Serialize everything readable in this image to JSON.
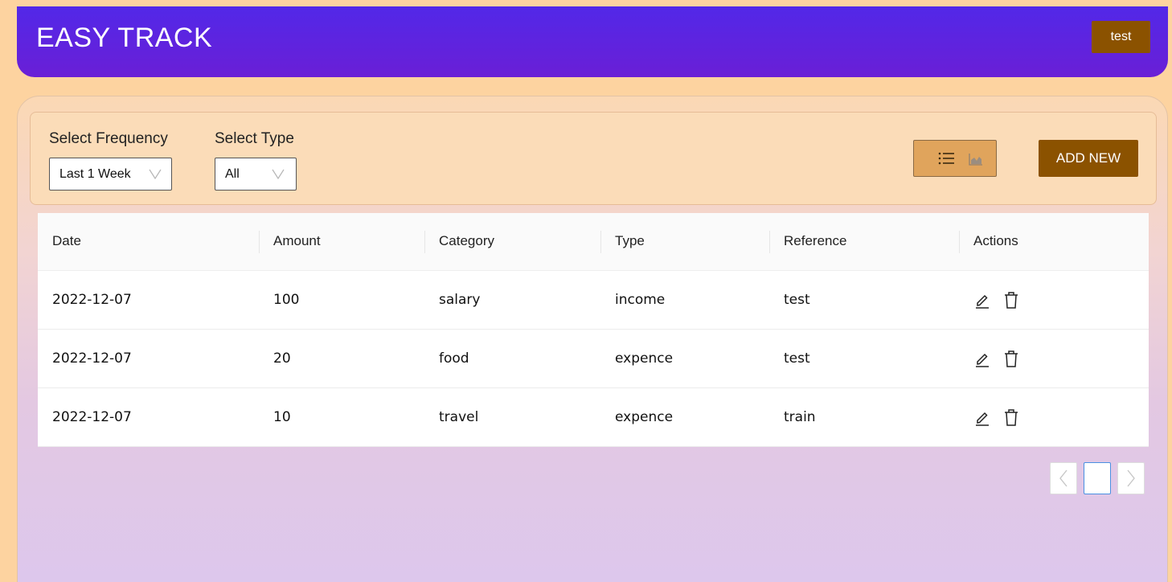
{
  "header": {
    "brand": "EASY TRACK",
    "user_label": "test"
  },
  "filters": {
    "frequency": {
      "label": "Select Frequency",
      "value": "Last 1 Week"
    },
    "type": {
      "label": "Select Type",
      "value": "All"
    }
  },
  "toolbar": {
    "list_icon": "list-icon",
    "chart_icon": "area-chart-icon",
    "add_label": "ADD NEW"
  },
  "table": {
    "columns": [
      "Date",
      "Amount",
      "Category",
      "Type",
      "Reference",
      "Actions"
    ],
    "rows": [
      {
        "date": "2022-12-07",
        "amount": "100",
        "category": "salary",
        "type": "income",
        "reference": "test"
      },
      {
        "date": "2022-12-07",
        "amount": "20",
        "category": "food",
        "type": "expence",
        "reference": "test"
      },
      {
        "date": "2022-12-07",
        "amount": "10",
        "category": "travel",
        "type": "expence",
        "reference": "train"
      }
    ],
    "row_action_icons": [
      "edit-icon",
      "delete-icon"
    ]
  },
  "pagination": {
    "current_page": ""
  },
  "colors": {
    "header_start": "#5228e8",
    "header_end": "#6a1fd6",
    "accent_brown": "#8b5200",
    "toggle_bg": "#e0a45c",
    "page_bg": "#fdd3a0"
  }
}
